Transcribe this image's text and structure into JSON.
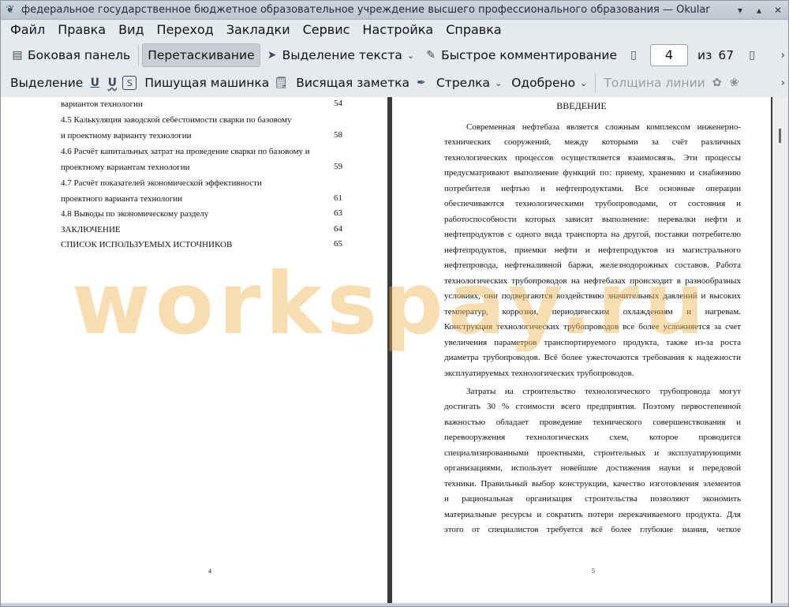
{
  "window": {
    "title": "федеральное государственное бюджетное образовательное учреждение высшего профессионального образования  — Okular"
  },
  "menu": [
    "Файл",
    "Правка",
    "Вид",
    "Переход",
    "Закладки",
    "Сервис",
    "Настройка",
    "Справка"
  ],
  "toolbar1": {
    "sidebar": "Боковая панель",
    "drag": "Перетаскивание",
    "text_select": "Выделение текста",
    "quick_comment": "Быстрое комментирование",
    "page_value": "4",
    "of_label": "из",
    "total_pages": "67"
  },
  "toolbar2": {
    "select": "Выделение",
    "typewriter": "Пишущая машинка",
    "hanging_note": "Висящая заметка",
    "arrow": "Стрелка",
    "approved": "Одобрено",
    "line_width": "Толщина линии"
  },
  "left_page": {
    "toc": [
      {
        "text": "вариантов технологии",
        "page": "54"
      },
      {
        "text": "4.5 Калькуляция заводской себестоимости сварки по базовому",
        "page": ""
      },
      {
        "text": "и проектному варианту технологии",
        "page": "58"
      },
      {
        "text": "4.6 Расчёт капитальных затрат на проведение сварки по базовому и",
        "page": ""
      },
      {
        "text": "проектному вариантам технологии",
        "page": "59"
      },
      {
        "text": "4.7 Расчёт показателей экономической эффективности",
        "page": ""
      },
      {
        "text": "проектного варианта технологии",
        "page": "61"
      },
      {
        "text": "4.8 Выводы по экономическому разделу",
        "page": "63"
      },
      {
        "text": "ЗАКЛЮЧЕНИЕ",
        "page": "64"
      },
      {
        "text": "СПИСОК ИСПОЛЬЗУЕМЫХ ИСТОЧНИКОВ",
        "page": "65"
      }
    ],
    "page_number": "4"
  },
  "right_page": {
    "heading": "ВВЕДЕНИЕ",
    "lines": [
      "Современная нефтебаза является сложным комплексом инженерно-",
      "технических сооружений, между которыми за счёт различных",
      "технологических процессов осуществляется взаимосвязь. Эти процессы",
      "предусматривают выполнение функций по: приему, хранению и снабжению",
      "потребителя нефтью и нефтепродуктами. Все основные операции",
      "обеспечиваются технологическими трубопроводами, от состояния и",
      "работоспособности которых зависит выполнение: перевалки нефти и",
      "нефтепродуктов с одного вида транспорта на другой, поставки потребителю",
      "нефтепродуктов, приемки нефти и нефтепродуктов из магистрального",
      "нефтепровода, нефтеналивной баржи, железнодорожных составов. Работа",
      "технологических трубопроводов на нефтебазах происходит в разнообразных",
      "условиях, они подвергаются воздействию значительных давлений и высоких",
      "температур, коррозии, периодическим охлаждениям и нагревам.",
      "Конструкция технологических трубопроводов все более усложняется за счет",
      "увеличения параметров транспортируемого продукта, также из-за роста",
      "диаметра трубопроводов. Всё более ужесточаются требования к надежности",
      "эксплуатируемых технологических трубопроводов.",
      "Затраты на строительство технологического трубопровода могут",
      "достигать 30 % стоимости всего предприятия. Поэтому первостепенной",
      "важностью обладает проведение технического совершенствования и",
      "перевооружения технологических схем, которое проводится",
      "специализированными проектными, строительных и эксплуатирующими",
      "организациями, использует новейшие достижения науки и передовой",
      "техники. Правильный выбор конструкции, качество изготовления элементов",
      "и рациональная организация строительства позволяют экономить",
      "материальные ресурсы и сократить потери перекачиваемого продукта. Для",
      "этого от специалистов требуется всё более глубокие знания, четкое"
    ],
    "page_number": "5"
  },
  "watermark": "workspay.ru"
}
